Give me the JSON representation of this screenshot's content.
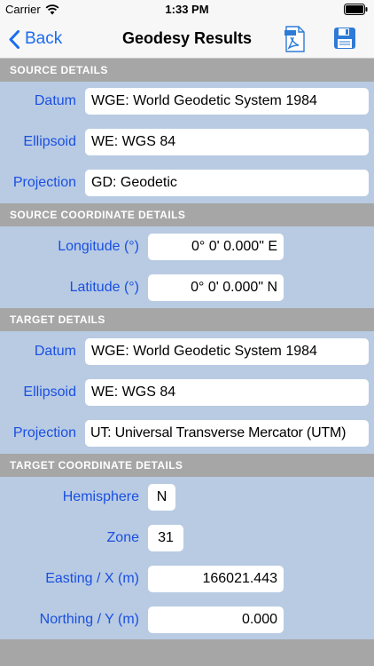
{
  "status_bar": {
    "carrier": "Carrier",
    "time": "1:33 PM",
    "wifi_icon": "wifi-icon",
    "battery_icon": "battery-icon"
  },
  "nav": {
    "back_label": "Back",
    "title": "Geodesy Results",
    "pdf_icon": "pdf-document-icon",
    "save_icon": "floppy-disk-icon",
    "accent_color": "#1a6cf0"
  },
  "colors": {
    "background": "#b8cbe3",
    "section_header": "#a6a6a6",
    "label": "#1a4fe0"
  },
  "source_details": {
    "header": "SOURCE DETAILS",
    "datum_label": "Datum",
    "datum_value": "WGE:  World Geodetic System 1984",
    "ellipsoid_label": "Ellipsoid",
    "ellipsoid_value": "WE:  WGS 84",
    "projection_label": "Projection",
    "projection_value": "GD: Geodetic"
  },
  "source_coordinates": {
    "header": "SOURCE COORDINATE DETAILS",
    "longitude_label": "Longitude (°)",
    "longitude_value": "0° 0' 0.000\" E",
    "latitude_label": "Latitude (°)",
    "latitude_value": "0° 0' 0.000\" N"
  },
  "target_details": {
    "header": "TARGET DETAILS",
    "datum_label": "Datum",
    "datum_value": "WGE:  World Geodetic System 1984",
    "ellipsoid_label": "Ellipsoid",
    "ellipsoid_value": "WE:  WGS 84",
    "projection_label": "Projection",
    "projection_value": "UT: Universal Transverse Mercator (UTM)"
  },
  "target_coordinates": {
    "header": "TARGET COORDINATE DETAILS",
    "hemisphere_label": "Hemisphere",
    "hemisphere_value": "N",
    "zone_label": "Zone",
    "zone_value": "31",
    "easting_label": "Easting / X (m)",
    "easting_value": "166021.443",
    "northing_label": "Northing / Y (m)",
    "northing_value": "0.000"
  }
}
